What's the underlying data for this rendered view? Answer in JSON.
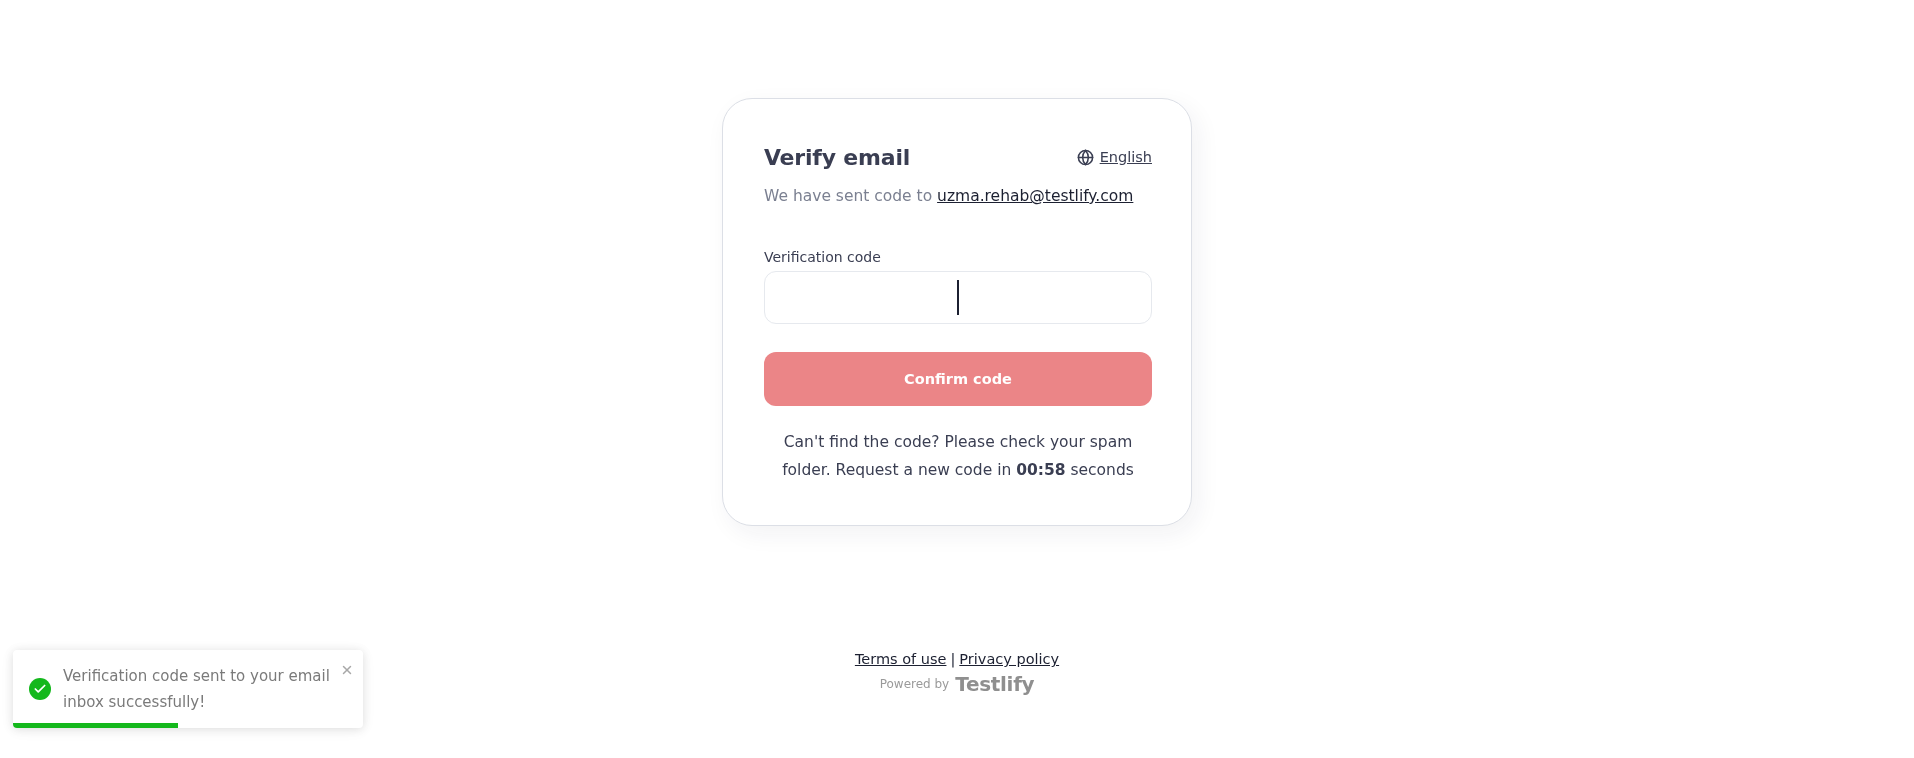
{
  "card": {
    "title": "Verify email",
    "language": {
      "label": "English"
    },
    "subtitle": "We have sent code to",
    "email": "uzma.rehab@testlify.com",
    "field": {
      "label": "Verification code",
      "focused": true
    },
    "button": {
      "label": "Confirm code",
      "disabled": true
    },
    "help_text": "Can't find the code? Please check your spam folder. Request a new code in **00:58** seconds"
  },
  "footer": {
    "links": [
      {
        "label": "Terms of use"
      },
      {
        "label": "Privacy policy"
      }
    ],
    "separator": "|",
    "powered_by": "Powered by",
    "brand": "Testlify"
  },
  "toast": {
    "kind": "success",
    "message": "Verification code sent to your email inbox successfully!",
    "level": 0.47
  }
}
